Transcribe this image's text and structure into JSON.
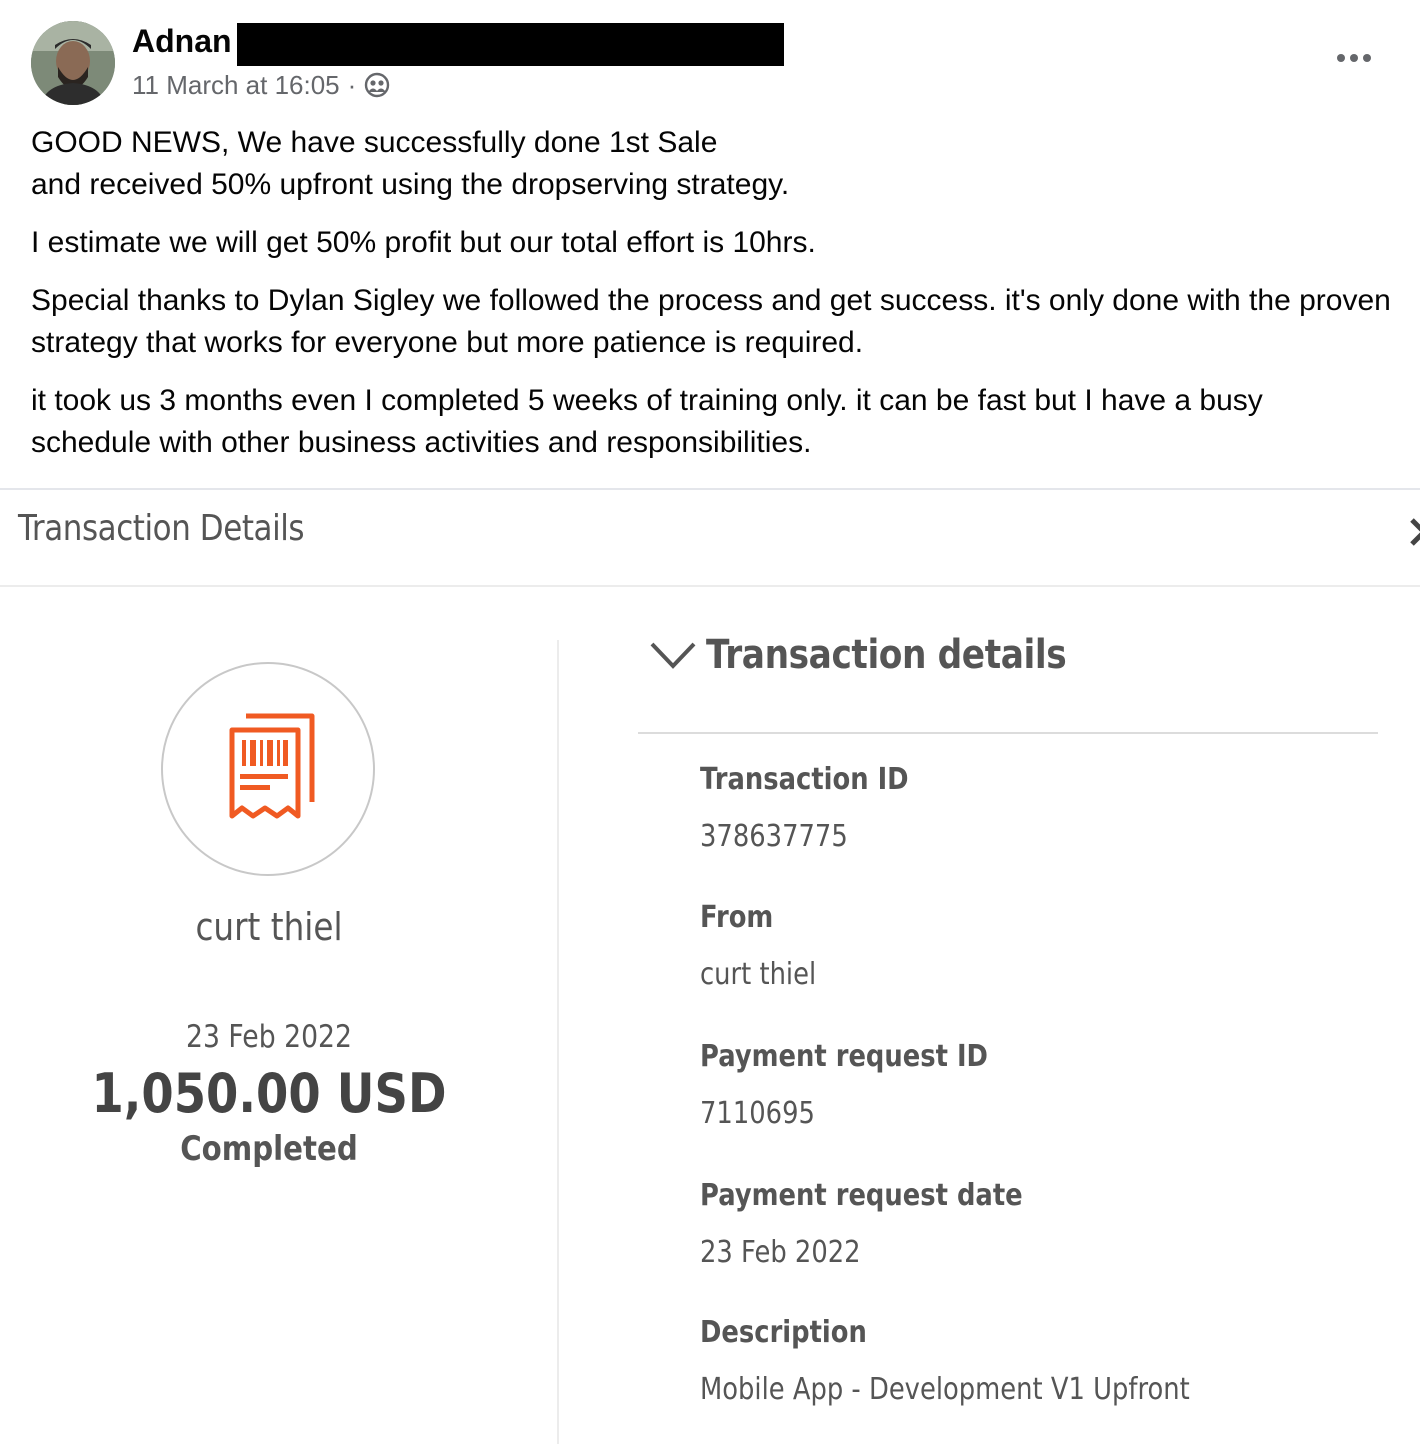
{
  "post": {
    "author": "Adnan",
    "timestamp": "11 March at 16:05",
    "separator": "·",
    "privacy_icon": "friends-icon",
    "more_icon": "more-options-icon",
    "paragraphs": [
      "GOOD NEWS, We have successfully done 1st Sale\nand received 50% upfront using the dropserving strategy.",
      "I estimate we will get 50% profit but our total effort is 10hrs.",
      "Special thanks to Dylan Sigley we followed the process and get success. it's only done with the proven strategy that works for everyone but more patience is required.",
      "it took us 3 months even I completed 5 weeks of training only. it can be fast but I have a busy schedule with other business activities and responsibilities."
    ]
  },
  "transaction": {
    "header_title": "Transaction Details",
    "payer_name": "curt thiel",
    "date": "23 Feb 2022",
    "amount": "1,050.00 USD",
    "status": "Completed",
    "accent_color": "#f05a22",
    "details_heading": "Transaction details",
    "fields": [
      {
        "label": "Transaction ID",
        "value": "378637775"
      },
      {
        "label": "From",
        "value": "curt thiel"
      },
      {
        "label": "Payment request ID",
        "value": "7110695"
      },
      {
        "label": "Payment request date",
        "value": "23 Feb 2022"
      },
      {
        "label": "Description",
        "value": "Mobile App - Development V1 Upfront"
      }
    ]
  }
}
